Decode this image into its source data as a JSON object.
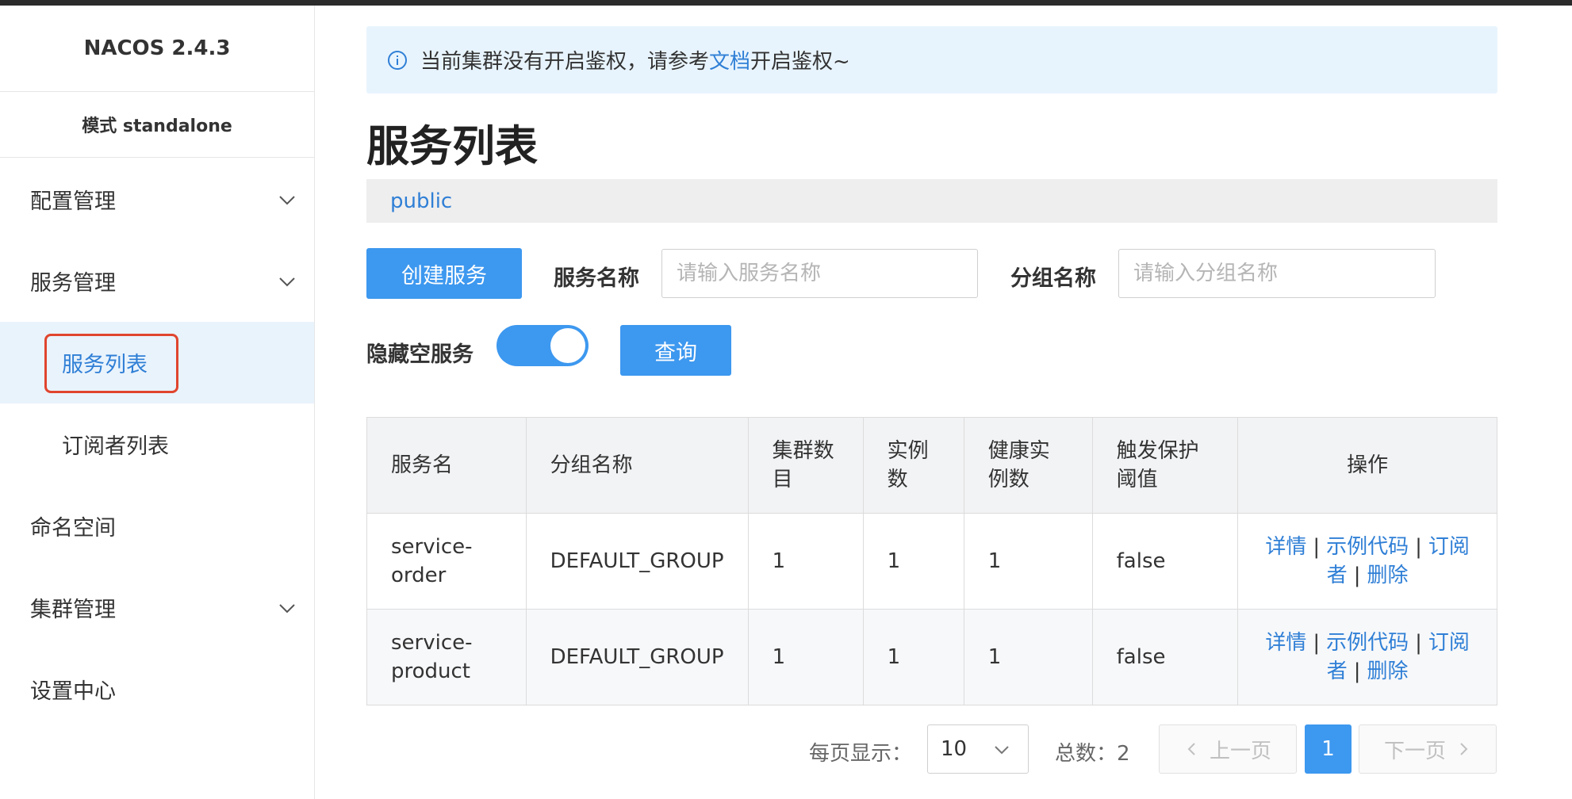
{
  "sidebar": {
    "brand": "NACOS 2.4.3",
    "mode": "模式 standalone",
    "menu": {
      "config": "配置管理",
      "service": "服务管理",
      "service_list": "服务列表",
      "subscriber_list": "订阅者列表",
      "namespace": "命名空间",
      "cluster": "集群管理",
      "settings": "设置中心"
    }
  },
  "notice": {
    "prefix": "当前集群没有开启鉴权，请参考",
    "link": "文档",
    "suffix": "开启鉴权~"
  },
  "page": {
    "title": "服务列表",
    "namespace": "public"
  },
  "filters": {
    "create_button": "创建服务",
    "service_name_label": "服务名称",
    "service_name_placeholder": "请输入服务名称",
    "group_name_label": "分组名称",
    "group_name_placeholder": "请输入分组名称",
    "hide_empty_label": "隐藏空服务",
    "hide_empty_on": true,
    "query_button": "查询"
  },
  "table": {
    "headers": {
      "service_name": "服务名",
      "group_name": "分组名称",
      "cluster_count": "集群数目",
      "instance_count": "实例数",
      "healthy_count": "健康实例数",
      "threshold": "触发保护阈值",
      "actions": "操作"
    },
    "rows": [
      {
        "service_name": "service-order",
        "group_name": "DEFAULT_GROUP",
        "cluster_count": "1",
        "instance_count": "1",
        "healthy_count": "1",
        "threshold": "false"
      },
      {
        "service_name": "service-product",
        "group_name": "DEFAULT_GROUP",
        "cluster_count": "1",
        "instance_count": "1",
        "healthy_count": "1",
        "threshold": "false"
      }
    ],
    "actions": {
      "detail": "详情",
      "sample_code": "示例代码",
      "subscribers": "订阅者",
      "delete": "删除",
      "separator": "|"
    }
  },
  "pagination": {
    "page_size_label": "每页显示：",
    "page_size": "10",
    "total_label": "总数：2",
    "prev": "上一页",
    "current": "1",
    "next": "下一页"
  },
  "colors": {
    "primary": "#3d98ef",
    "link": "#2f7fd6",
    "highlight_box": "#e0452e",
    "notice_bg": "#e8f4fd"
  }
}
